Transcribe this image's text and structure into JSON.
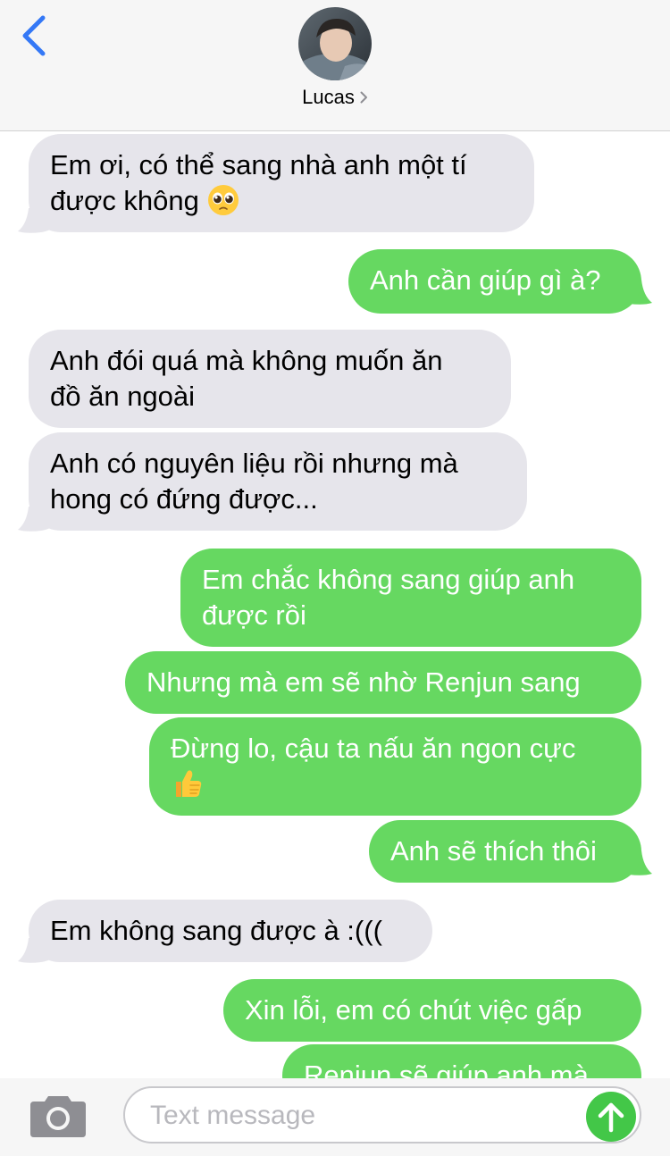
{
  "header": {
    "back_icon": "chevron-left-icon",
    "contact_name": "Lucas",
    "contact_chevron_icon": "chevron-right-icon"
  },
  "messages": [
    {
      "direction": "incoming",
      "lines": [
        "Em ơi, có thể sang nhà anh một tí",
        "được không"
      ],
      "emoji": "pleading-face-emoji"
    },
    {
      "direction": "outgoing",
      "lines": [
        "Anh cần giúp gì à?"
      ]
    },
    {
      "direction": "incoming",
      "lines": [
        "Anh đói quá mà không muốn ăn",
        "đồ ăn ngoài"
      ]
    },
    {
      "direction": "incoming",
      "lines": [
        "Anh có nguyên liệu rồi nhưng mà",
        "hong có đứng được..."
      ]
    },
    {
      "direction": "outgoing",
      "lines": [
        "Em chắc không sang giúp anh",
        "được rồi"
      ]
    },
    {
      "direction": "outgoing",
      "lines": [
        "Nhưng mà em sẽ nhờ Renjun sang"
      ]
    },
    {
      "direction": "outgoing",
      "lines": [
        "Đừng lo, cậu ta nấu ăn ngon cực"
      ],
      "emoji": "thumbs-up-emoji"
    },
    {
      "direction": "outgoing",
      "lines": [
        "Anh sẽ thích thôi"
      ]
    },
    {
      "direction": "incoming",
      "lines": [
        "Em không sang được à :((("
      ]
    },
    {
      "direction": "outgoing",
      "lines": [
        "Xin lỗi, em có chút việc gấp"
      ]
    },
    {
      "direction": "outgoing",
      "lines": [
        "Renjun sẽ giúp anh mà"
      ]
    }
  ],
  "compose": {
    "camera_icon": "camera-icon",
    "placeholder": "Text message",
    "send_icon": "arrow-up-icon"
  },
  "colors": {
    "incoming_bubble": "#e6e5eb",
    "outgoing_bubble": "#66d861",
    "send_button": "#43c748",
    "ios_blue": "#3478f6"
  }
}
